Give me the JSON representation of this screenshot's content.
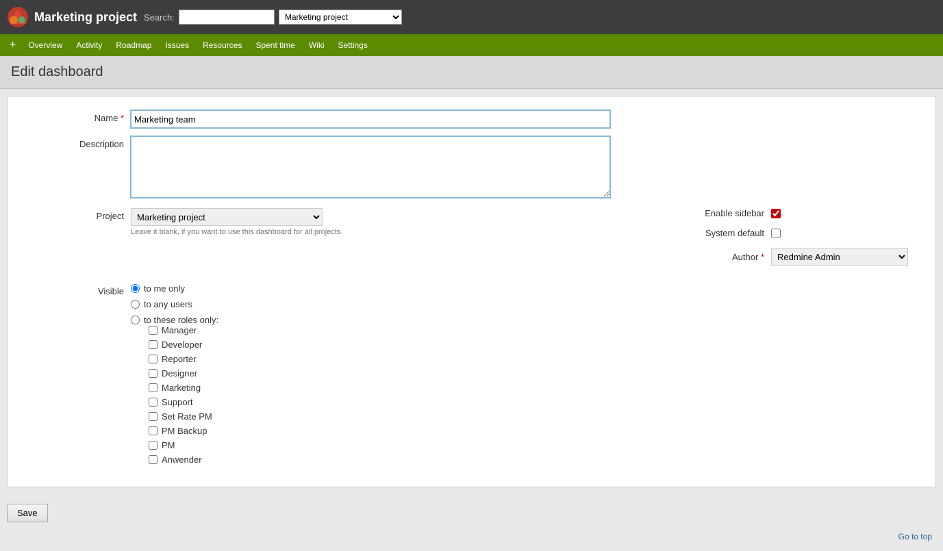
{
  "header": {
    "title": "Marketing project",
    "search_label": "Search:",
    "search_placeholder": "",
    "search_project_value": "Marketing project"
  },
  "nav": {
    "plus_label": "+",
    "items": [
      {
        "label": "Overview"
      },
      {
        "label": "Activity"
      },
      {
        "label": "Roadmap"
      },
      {
        "label": "Issues"
      },
      {
        "label": "Resources"
      },
      {
        "label": "Spent time"
      },
      {
        "label": "Wiki"
      },
      {
        "label": "Settings"
      }
    ]
  },
  "page": {
    "title": "Edit dashboard"
  },
  "form": {
    "name_label": "Name",
    "name_required": "*",
    "name_value": "Marketing team",
    "description_label": "Description",
    "description_value": "",
    "project_label": "Project",
    "project_value": "Marketing project",
    "project_hint": "Leave it blank, if you want to use this dashboard for all projects.",
    "enable_sidebar_label": "Enable sidebar",
    "system_default_label": "System default",
    "visible_label": "Visible",
    "visible_options": [
      {
        "label": "to me only",
        "value": "me",
        "checked": true
      },
      {
        "label": "to any users",
        "value": "any",
        "checked": false
      },
      {
        "label": "to these roles only:",
        "value": "roles",
        "checked": false
      }
    ],
    "roles": [
      {
        "label": "Manager",
        "checked": false
      },
      {
        "label": "Developer",
        "checked": false
      },
      {
        "label": "Reporter",
        "checked": false
      },
      {
        "label": "Designer",
        "checked": false
      },
      {
        "label": "Marketing",
        "checked": false
      },
      {
        "label": "Support",
        "checked": false
      },
      {
        "label": "Set Rate PM",
        "checked": false
      },
      {
        "label": "PM Backup",
        "checked": false
      },
      {
        "label": "PM",
        "checked": false
      },
      {
        "label": "Anwender",
        "checked": false
      }
    ],
    "author_label": "Author",
    "author_required": "*",
    "author_value": "Redmine Admin",
    "save_label": "Save"
  },
  "footer": {
    "goto_top": "Go to top"
  }
}
